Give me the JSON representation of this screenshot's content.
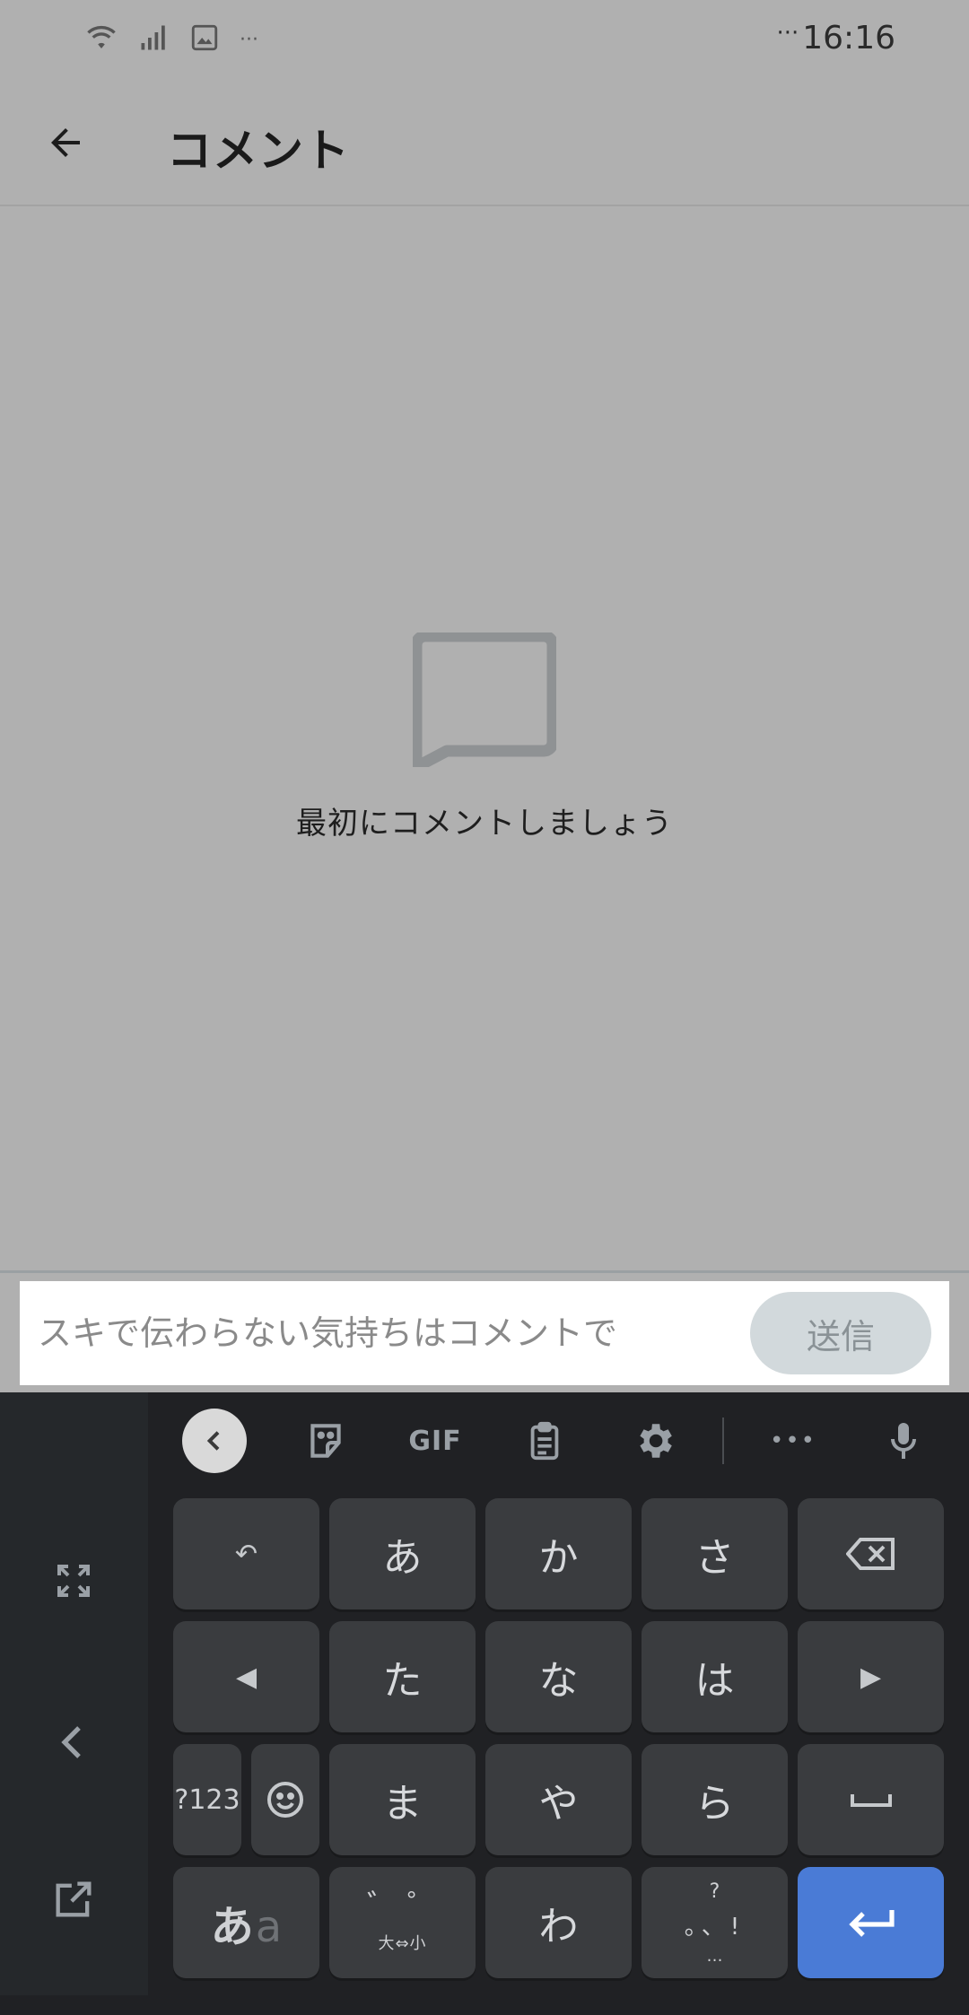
{
  "status_bar": {
    "time": "16:16",
    "dots": "···",
    "icons": [
      "wifi-icon",
      "signal-icon",
      "image-icon",
      "more-dots-icon"
    ]
  },
  "app_bar": {
    "title": "コメント",
    "back_icon": "arrow-left-icon"
  },
  "empty_state": {
    "icon": "comment-bubble-icon",
    "message": "最初にコメントしましょう"
  },
  "composer": {
    "placeholder": "スキで伝わらない気持ちはコメントで",
    "value": "",
    "send_label": "送信"
  },
  "keyboard": {
    "toolbar": {
      "collapse_icon": "chevron-left-icon",
      "sticker_icon": "sticker-icon",
      "gif_label": "GIF",
      "clipboard_icon": "clipboard-icon",
      "settings_icon": "gear-icon",
      "more_label": "•••",
      "mic_icon": "microphone-icon"
    },
    "side": [
      "expand-icon",
      "chevron-left-icon",
      "floating-keyboard-icon"
    ],
    "keys": {
      "undo": "↶",
      "a": "あ",
      "ka": "か",
      "sa": "さ",
      "backspace": "⌫",
      "left": "◀",
      "ta": "た",
      "na": "な",
      "ha": "は",
      "right": "▶",
      "num": "?123",
      "emoji": "☺",
      "ma": "ま",
      "ya": "や",
      "ra": "ら",
      "space": "␣",
      "mode_hira": "あ",
      "mode_alpha": "a",
      "dakuten_top": "゛ ゜",
      "dakuten_bottom": "大⇔小",
      "wa": "わ",
      "punct_top": "?",
      "punct_mid": "。、!",
      "punct_bottom": "…",
      "enter": "↵"
    }
  },
  "colors": {
    "scrim": "#b0b0b0",
    "keyboard_bg": "#202124",
    "key_bg": "#3a3c3f",
    "enter_key": "#4a7bd6",
    "send_button": "#d2d9dc"
  }
}
